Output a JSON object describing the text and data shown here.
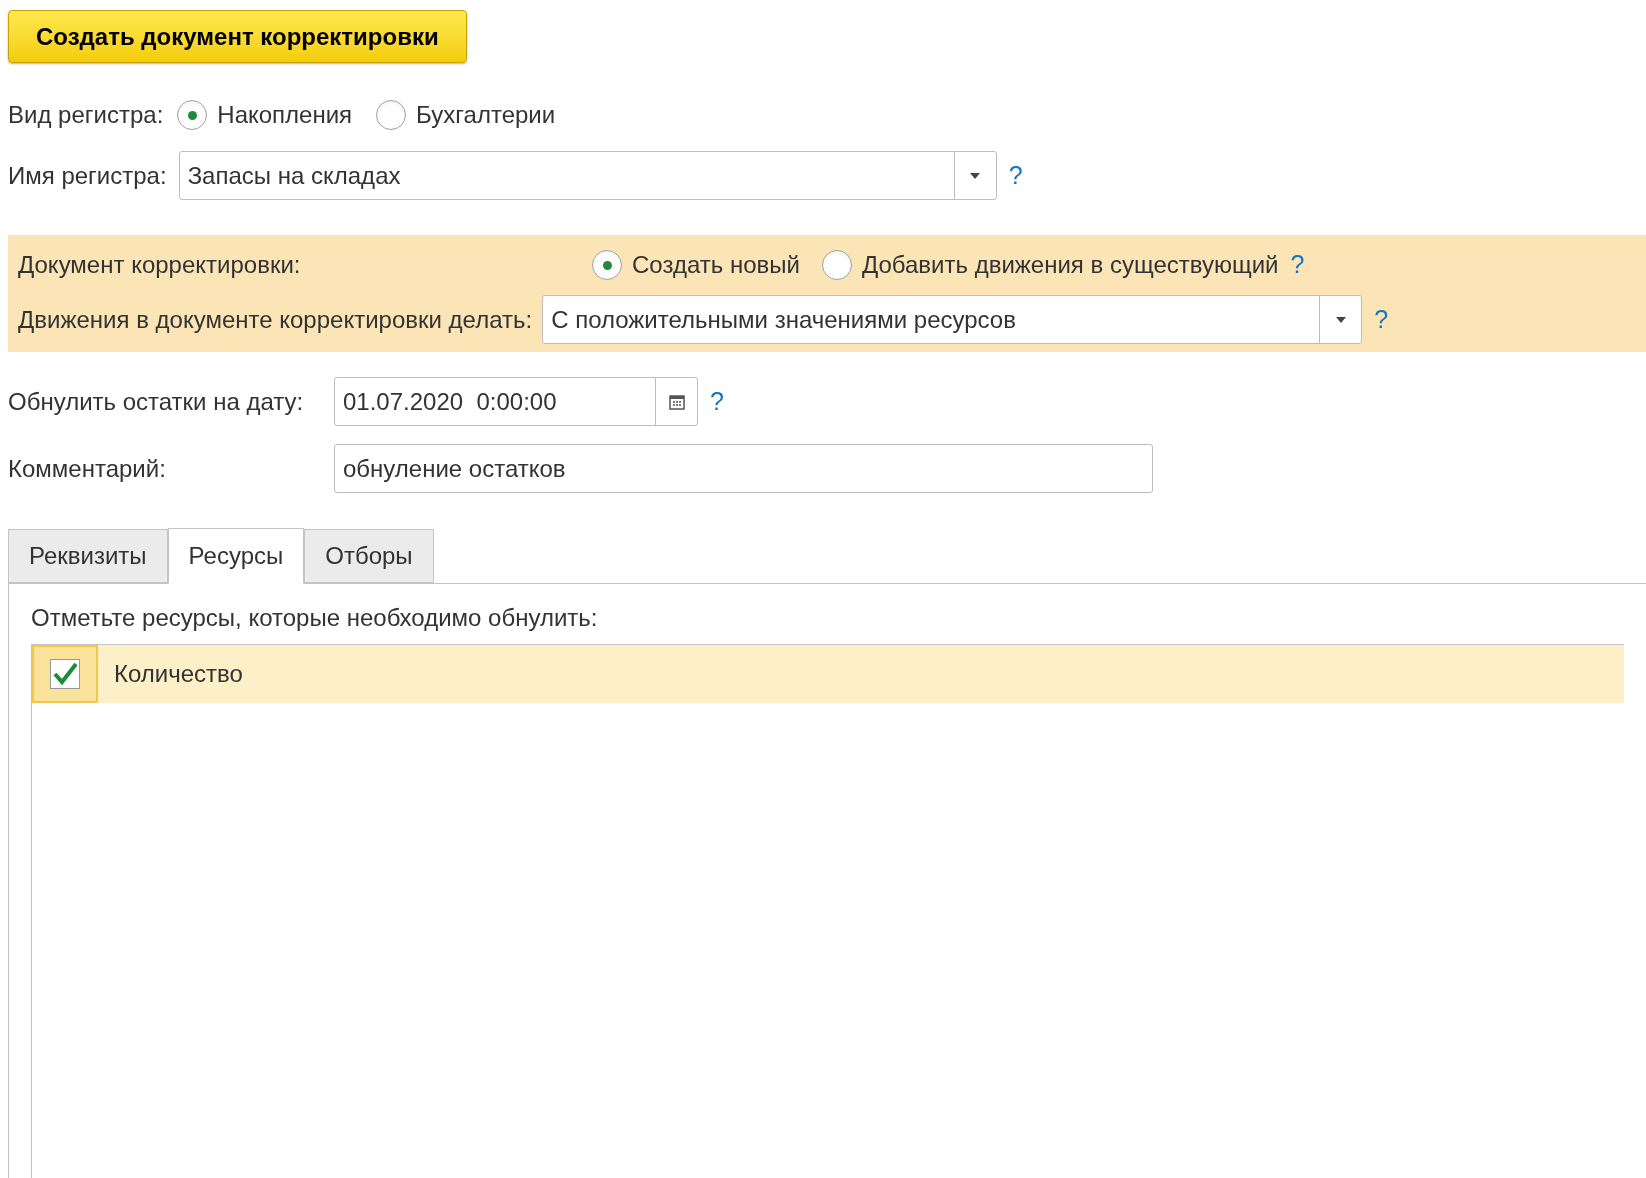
{
  "create_button": "Создать документ корректировки",
  "register_kind": {
    "label": "Вид регистра:",
    "options": [
      {
        "label": "Накопления",
        "selected": true
      },
      {
        "label": "Бухгалтерии",
        "selected": false
      }
    ]
  },
  "register_name": {
    "label": "Имя регистра:",
    "value": "Запасы на складах",
    "help": "?"
  },
  "correction": {
    "doc_label": "Документ корректировки:",
    "options": [
      {
        "label": "Создать новый",
        "selected": true
      },
      {
        "label": "Добавить движения в существующий",
        "selected": false
      }
    ],
    "options_help": "?",
    "movements_label": "Движения в документе корректировки делать:",
    "movements_value": "С положительными значениями ресурсов",
    "movements_help": "?"
  },
  "reset_date": {
    "label": "Обнулить остатки на дату:",
    "value": "01.07.2020  0:00:00",
    "help": "?"
  },
  "comment": {
    "label": "Комментарий:",
    "value": "обнуление остатков"
  },
  "tabs": [
    {
      "label": "Реквизиты",
      "selected": false
    },
    {
      "label": "Ресурсы",
      "selected": true
    },
    {
      "label": "Отборы",
      "selected": false
    }
  ],
  "resources": {
    "hint": "Отметьте ресурсы, которые необходимо обнулить:",
    "rows": [
      {
        "label": "Количество",
        "checked": true
      }
    ]
  }
}
